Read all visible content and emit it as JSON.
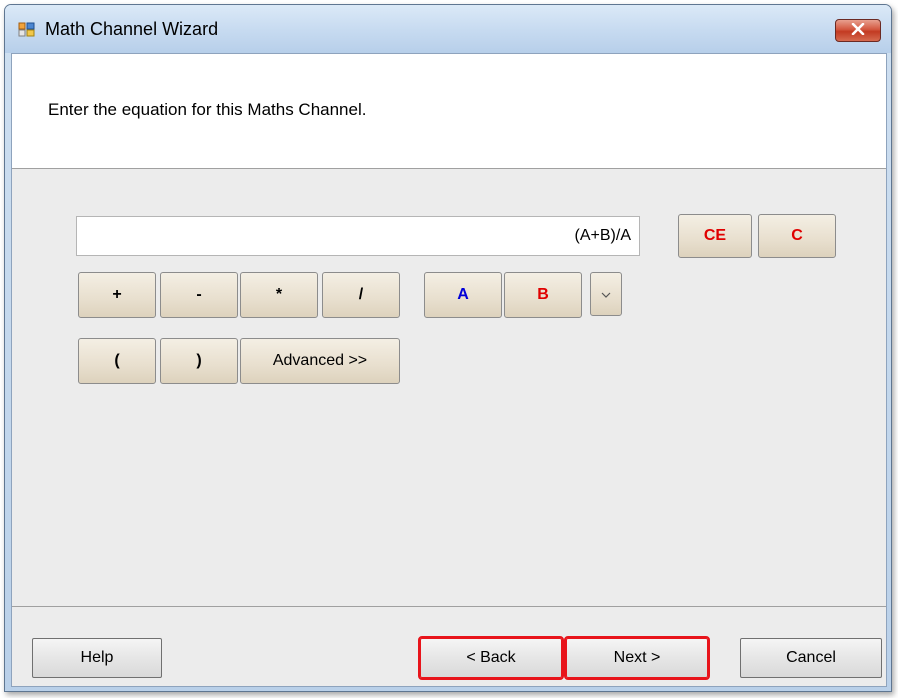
{
  "window": {
    "title": "Math Channel Wizard",
    "app_icon": "window-app-icon",
    "close_icon": "close-x-icon"
  },
  "header": {
    "instruction": "Enter the equation for this Maths Channel."
  },
  "equation": {
    "value": "(A+B)/A"
  },
  "calculator": {
    "clear_entry": "CE",
    "clear": "C",
    "plus": "+",
    "minus": "-",
    "multiply": "*",
    "divide": "/",
    "channel_a": "A",
    "channel_b": "B",
    "open_paren": "(",
    "close_paren": ")",
    "advanced": "Advanced >>",
    "more_channels_icon": "chevron-down-icon"
  },
  "footer": {
    "help": "Help",
    "back": "< Back",
    "next": "Next >",
    "cancel": "Cancel"
  },
  "colors": {
    "red_label": "#e00000",
    "blue_label": "#0000d8",
    "highlight_outline": "#e8141b"
  }
}
